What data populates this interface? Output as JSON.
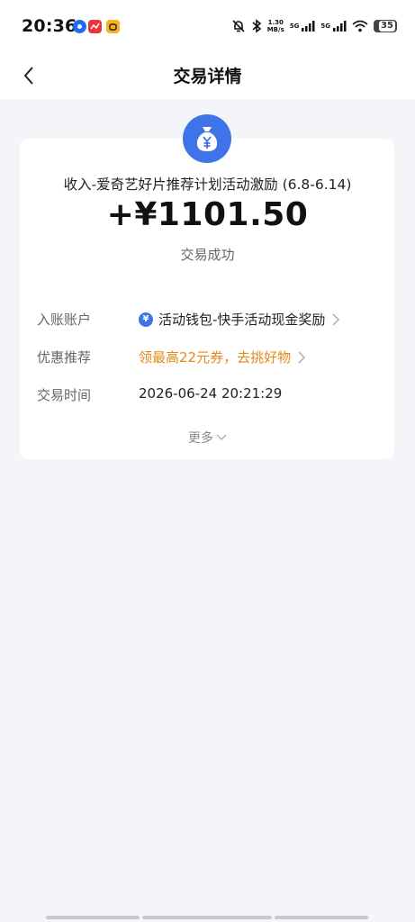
{
  "status_bar": {
    "time": "20:36",
    "net_speed_value": "1.30",
    "net_speed_unit": "MB/s",
    "signal_1": "5G",
    "signal_2": "5G",
    "battery": "35",
    "icons": [
      "notification-app-icon",
      "red-app-icon",
      "yellow-app-icon",
      "bell-muted-icon",
      "bluetooth-icon",
      "signal-icon",
      "signal-icon",
      "wifi-icon",
      "battery-icon"
    ]
  },
  "header": {
    "title": "交易详情",
    "back_icon": "chevron-left-icon"
  },
  "transaction": {
    "icon": "money-bag-icon",
    "title": "收入-爱奇艺好片推荐计划活动激励 (6.8-6.14)",
    "amount": "+¥1101.50",
    "status": "交易成功"
  },
  "details": {
    "account_label": "入账账户",
    "account_value": "活动钱包-快手活动现金奖励",
    "promo_label": "优惠推荐",
    "promo_value": "领最高22元券，去挑好物",
    "time_label": "交易时间",
    "time_value": "2026-06-24 20:21:29"
  },
  "more": {
    "label": "更多"
  },
  "colors": {
    "accent_blue": "#3f74e8",
    "promo_orange": "#e28a1a",
    "page_bg": "#f4f5f9"
  }
}
